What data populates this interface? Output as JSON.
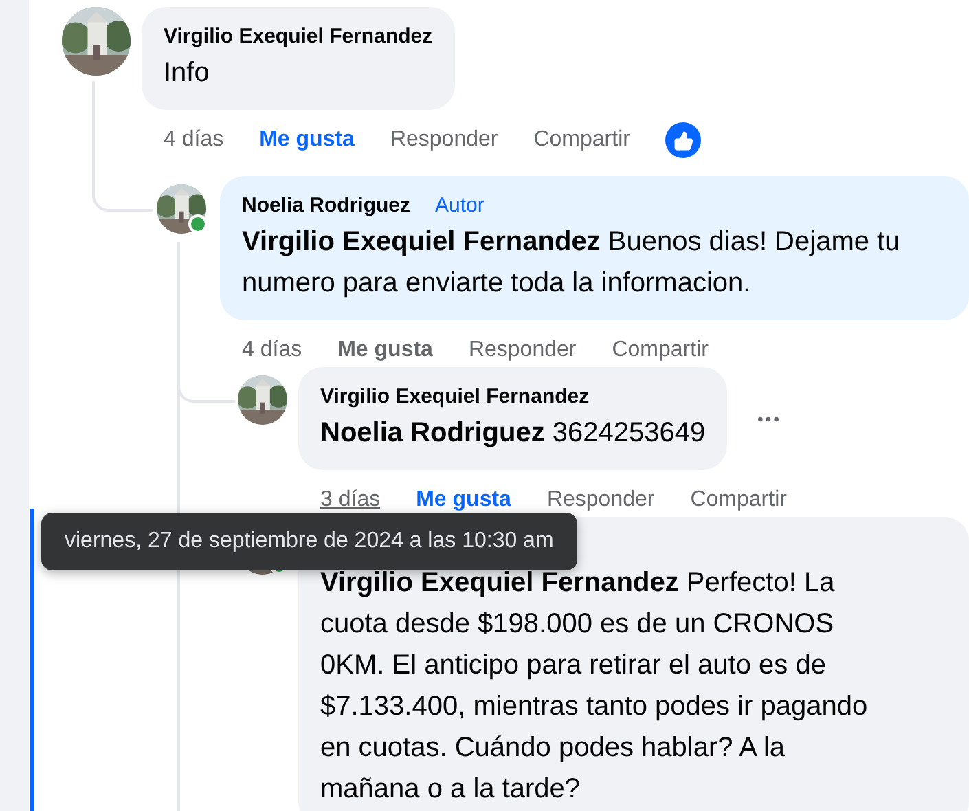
{
  "comments": [
    {
      "author": "Virgilio Exequiel Fernandez",
      "text": "Info",
      "time": "4 días",
      "time_hovered": false,
      "liked": true,
      "has_reaction": true,
      "actions": [
        "Me gusta",
        "Responder",
        "Compartir"
      ],
      "children": [
        {
          "author": "Noelia Rodriguez",
          "online": true,
          "badge": "Autor",
          "text": "**Virgilio Exequiel Fernandez** Buenos dias! Dejame tu numero para enviarte toda la informacion.",
          "time": "4 días",
          "time_hovered": false,
          "liked": false,
          "actions": [
            "Me gusta",
            "Responder",
            "Compartir"
          ],
          "children": [
            {
              "author": "Virgilio Exequiel Fernandez",
              "text": "**Noelia Rodriguez** 3624253649",
              "time": "3 días",
              "time_hovered": true,
              "liked": true,
              "show_menu": true,
              "actions": [
                "Me gusta",
                "Responder",
                "Compartir"
              ]
            },
            {
              "online": true,
              "text": "**Virgilio Exequiel Fernandez** Perfecto! La cuota desde $198.000 es de un CRONOS 0KM. El anticipo para retirar el auto es de $7.133.400, mientras tanto podes ir pagando en cuotas. Cuándo podes hablar? A la mañana o a la tarde?",
              "focused": true
            }
          ]
        }
      ]
    }
  ],
  "tooltip": {
    "text": "viernes, 27 de septiembre de 2024 a las 10:30 am"
  }
}
